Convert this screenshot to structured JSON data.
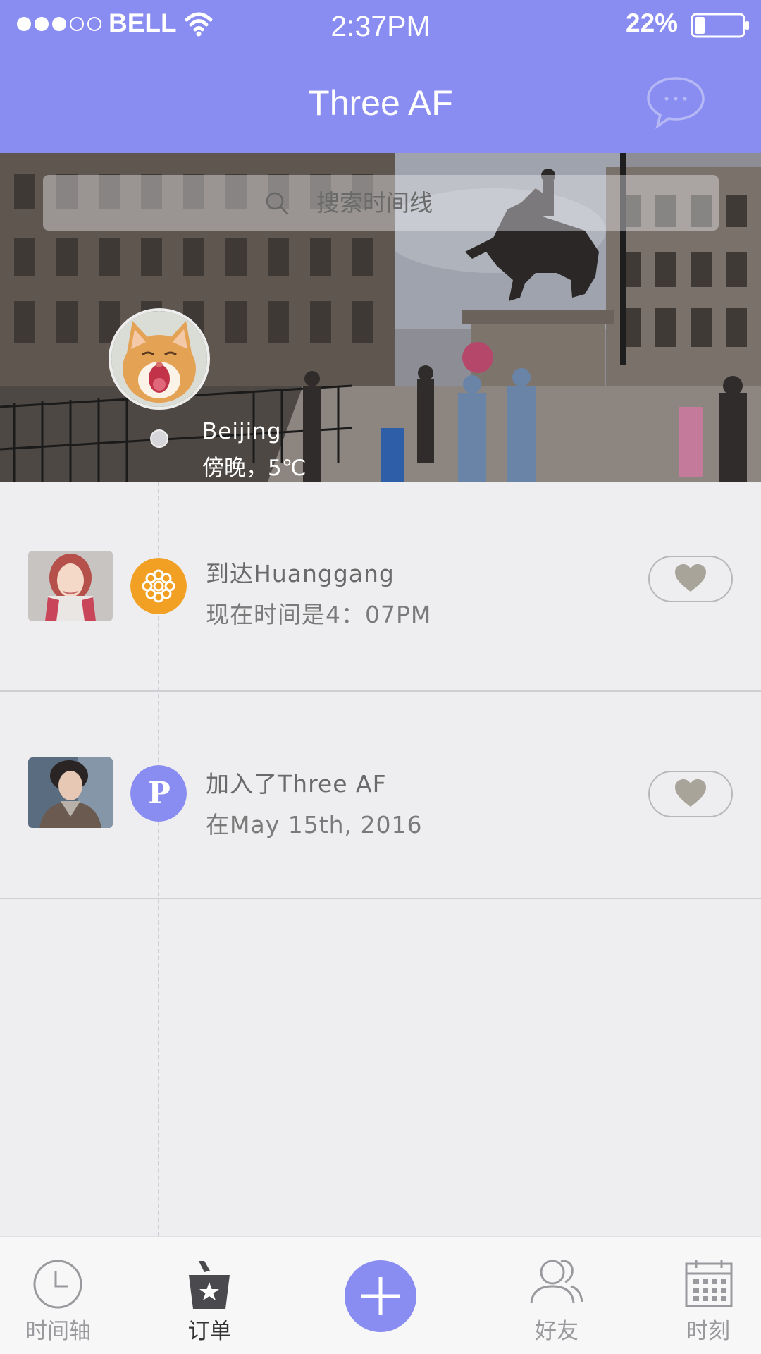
{
  "status_bar": {
    "carrier": "BELL",
    "time": "2:37PM",
    "battery": "22%",
    "battery_level": 0.22,
    "signal_bars_filled": 3,
    "signal_bars_total": 5
  },
  "header": {
    "title": "Three AF",
    "chat_icon": "chat-bubble-icon"
  },
  "hero": {
    "search_placeholder": "搜索时间线",
    "search_icon": "search-icon",
    "city": "Beijing",
    "weather": "傍晚，5℃"
  },
  "feed": [
    {
      "title": "到达Huanggang",
      "subtitle": "现在时间是4：07PM",
      "badge_icon": "flower-icon",
      "badge_color": "#f2a023",
      "like_icon": "heart-icon"
    },
    {
      "title": "加入了Three AF",
      "subtitle": "在May 15th, 2016",
      "badge_icon": "p-letter-icon",
      "badge_letter": "P",
      "badge_color": "#898cf0",
      "like_icon": "heart-icon"
    }
  ],
  "tabbar": {
    "items": [
      {
        "label": "时间轴",
        "icon": "clock-icon"
      },
      {
        "label": "订单",
        "icon": "order-bag-icon"
      },
      {
        "label": "",
        "icon": "plus-icon"
      },
      {
        "label": "好友",
        "icon": "friends-icon"
      },
      {
        "label": "时刻",
        "icon": "calendar-icon"
      }
    ],
    "active_index": 1
  },
  "colors": {
    "accent": "#898cf0",
    "orange": "#f2a023",
    "background": "#eeeef0"
  }
}
